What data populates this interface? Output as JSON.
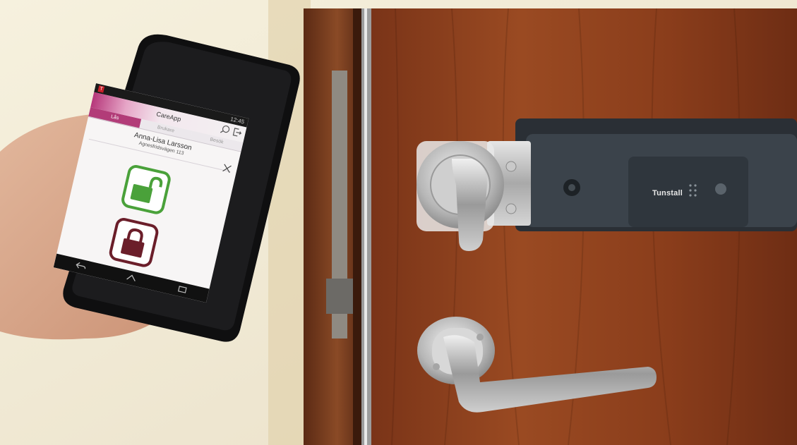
{
  "phone": {
    "status": {
      "time": "12:45",
      "badge": "T"
    },
    "app": {
      "title": "CareApp",
      "tabs": [
        {
          "label": "Lås",
          "active": true
        },
        {
          "label": "Brukare",
          "active": false
        },
        {
          "label": "Besök",
          "active": false
        }
      ]
    },
    "patient": {
      "name": "Anna-Lisa Larsson",
      "address": "Agnesfridsvägen 113"
    },
    "unlock_button": {
      "icon": "unlock-icon",
      "color": "#4aa13a"
    },
    "lock_button": {
      "icon": "lock-icon",
      "color": "#6b1e2a"
    },
    "nav_icons": [
      "back-icon",
      "home-icon",
      "recents-icon"
    ]
  },
  "door_lock": {
    "brand": "Tunstall"
  },
  "colors": {
    "accent": "#b23c78",
    "door": "#8a3f1d"
  }
}
